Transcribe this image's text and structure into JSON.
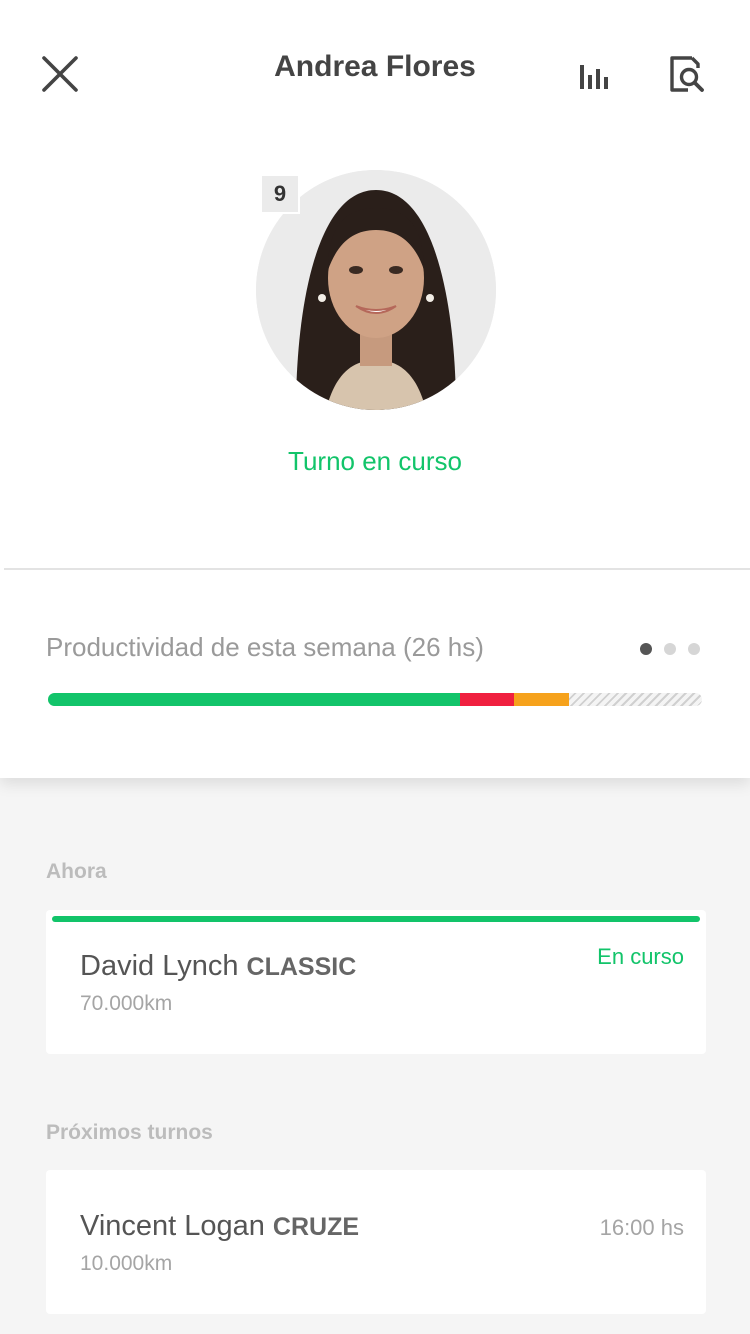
{
  "header": {
    "title": "Andrea Flores"
  },
  "profile": {
    "badge": "9",
    "status": "Turno en curso"
  },
  "productivity": {
    "label": "Productividad de esta semana (26 hs)",
    "segments": [
      {
        "name": "productive",
        "fraction": 0.63,
        "color": "#12c46a"
      },
      {
        "name": "idle",
        "fraction": 0.083,
        "color": "#f0203f"
      },
      {
        "name": "paused",
        "fraction": 0.083,
        "color": "#f6a21c"
      }
    ],
    "pages": 3,
    "active_page": 0
  },
  "now": {
    "label": "Ahora",
    "card": {
      "name": "David Lynch",
      "model": "CLASSIC",
      "km": "70.000km",
      "status": "En curso"
    }
  },
  "upcoming": {
    "label": "Próximos turnos",
    "card": {
      "name": "Vincent Logan",
      "model": "CRUZE",
      "km": "10.000km",
      "time": "16:00 hs"
    }
  },
  "colors": {
    "accent": "#12c46a",
    "red": "#f0203f",
    "orange": "#f6a21c"
  },
  "icons": {
    "close": "close-icon",
    "stats": "bar-chart-icon",
    "search": "document-search-icon"
  }
}
